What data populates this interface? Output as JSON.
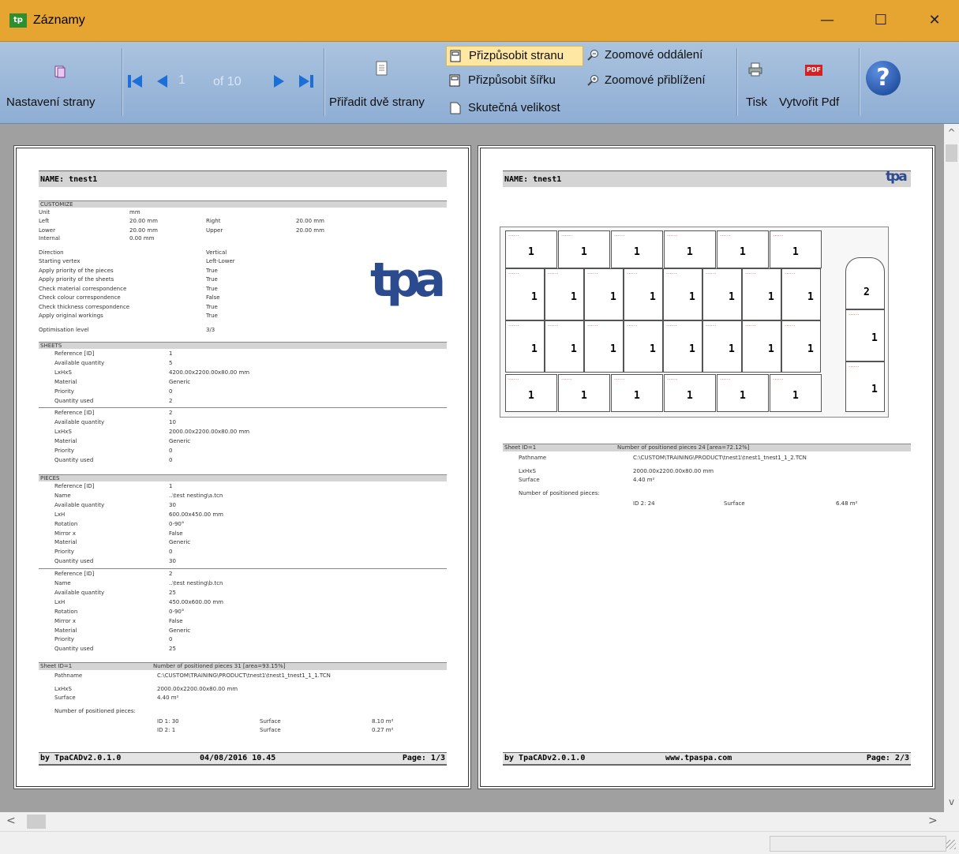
{
  "window": {
    "title": "Záznamy",
    "app_icon": "tpa-app-icon",
    "minimize": "—",
    "maximize": "☐",
    "close": "✕"
  },
  "toolbar": {
    "page_setup_label": "Nastavení strany",
    "nav": {
      "current_page": "1",
      "of_label": "of 10"
    },
    "two_pages_label": "Přiřadit dvě strany",
    "fit_page_label": "Přizpůsobit stranu",
    "fit_width_label": "Přizpůsobit šířku",
    "actual_size_label": "Skutečná velikost",
    "zoom_out_label": "Zoomové oddálení",
    "zoom_in_label": "Zoomové přiblížení",
    "print_label": "Tisk",
    "create_pdf_label": "Vytvořit Pdf",
    "pdf_badge": "PDF",
    "help_glyph": "?"
  },
  "page1": {
    "name_header": "NAME: tnest1",
    "customize": {
      "title": "CUSTOMIZE",
      "unit_label": "Unit",
      "unit_value": "mm",
      "left_label": "Left",
      "left_value": "20.00 mm",
      "right_label": "Right",
      "right_value": "20.00 mm",
      "lower_label": "Lower",
      "lower_value": "20.00 mm",
      "upper_label": "Upper",
      "upper_value": "20.00 mm",
      "internal_label": "Internal",
      "internal_value": "0.00 mm",
      "options": [
        {
          "label": "Direction",
          "value": "Vertical"
        },
        {
          "label": "Starting vertex",
          "value": "Left-Lower"
        },
        {
          "label": "Apply priority of the pieces",
          "value": "True"
        },
        {
          "label": "Apply priority of the sheets",
          "value": "True"
        },
        {
          "label": "Check material correspondence",
          "value": "True"
        },
        {
          "label": "Check colour correspondence",
          "value": "False"
        },
        {
          "label": "Check thickness correspondence",
          "value": "True"
        },
        {
          "label": "Apply original workings",
          "value": "True"
        }
      ],
      "opt_level_label": "Optimisation level",
      "opt_level_value": "3/3"
    },
    "sheets": {
      "title": "SHEETS",
      "items": [
        [
          {
            "label": "Reference [ID]",
            "value": "1"
          },
          {
            "label": "Available quantity",
            "value": "5"
          },
          {
            "label": "LxHxS",
            "value": "4200.00x2200.00x80.00 mm"
          },
          {
            "label": "Material",
            "value": "Generic"
          },
          {
            "label": "Priority",
            "value": "0"
          },
          {
            "label": "Quantity used",
            "value": "2"
          }
        ],
        [
          {
            "label": "Reference [ID]",
            "value": "2"
          },
          {
            "label": "Available quantity",
            "value": "10"
          },
          {
            "label": "LxHxS",
            "value": "2000.00x2200.00x80.00 mm"
          },
          {
            "label": "Material",
            "value": "Generic"
          },
          {
            "label": "Priority",
            "value": "0"
          },
          {
            "label": "Quantity used",
            "value": "0"
          }
        ]
      ]
    },
    "pieces": {
      "title": "PIECES",
      "items": [
        [
          {
            "label": "Reference [ID]",
            "value": "1"
          },
          {
            "label": "Name",
            "value": "..\\test nesting\\a.tcn"
          },
          {
            "label": "Available quantity",
            "value": "30"
          },
          {
            "label": "LxH",
            "value": "600.00x450.00 mm"
          },
          {
            "label": "Rotation",
            "value": "0-90°"
          },
          {
            "label": "Mirror x",
            "value": "False"
          },
          {
            "label": "Material",
            "value": "Generic"
          },
          {
            "label": "Priority",
            "value": "0"
          },
          {
            "label": "Quantity used",
            "value": "30"
          }
        ],
        [
          {
            "label": "Reference [ID]",
            "value": "2"
          },
          {
            "label": "Name",
            "value": "..\\test nesting\\b.tcn"
          },
          {
            "label": "Available quantity",
            "value": "25"
          },
          {
            "label": "LxH",
            "value": "450.00x600.00 mm"
          },
          {
            "label": "Rotation",
            "value": "0-90°"
          },
          {
            "label": "Mirror x",
            "value": "False"
          },
          {
            "label": "Material",
            "value": "Generic"
          },
          {
            "label": "Priority",
            "value": "0"
          },
          {
            "label": "Quantity used",
            "value": "25"
          }
        ]
      ]
    },
    "sheet_summary": {
      "header_left": "Sheet  ID=1",
      "header_right": "Number of positioned pieces  31   [area=93.15%]",
      "pathname_label": "Pathname",
      "pathname_value": "C:\\CUSTOM\\TRAINING\\PRODUCT\\tnest1\\tnest1_tnest1_1_1.TCN",
      "lxhxs_label": "LxHxS",
      "lxhxs_value": "2000.00x2200.00x80.00 mm",
      "surface_label": "Surface",
      "surface_value": "4.40  m²",
      "npp_label": "Number of positioned pieces:",
      "rows": [
        {
          "id": "ID  1:  30",
          "surface_label": "Surface",
          "surface": "8.10  m²"
        },
        {
          "id": "ID  2:  1",
          "surface_label": "Surface",
          "surface": "0.27  m²"
        }
      ]
    },
    "footer": {
      "left": "by TpaCADv2.0.1.0",
      "center": "04/08/2016 10.45",
      "right": "Page: 1/3"
    },
    "logo_text": "tpa"
  },
  "page2": {
    "name_header": "NAME: tnest1",
    "logo_text": "tpa",
    "piece_label_1": "1",
    "piece_label_2": "2",
    "sheet_summary": {
      "header_left": "Sheet  ID=1",
      "header_right": "Number of positioned pieces  24   [area=72.12%]",
      "pathname_label": "Pathname",
      "pathname_value": "C:\\CUSTOM\\TRAINING\\PRODUCT\\tnest1\\tnest1_tnest1_1_2.TCN",
      "lxhxs_label": "LxHxS",
      "lxhxs_value": "2000.00x2200.00x80.00 mm",
      "surface_label": "Surface",
      "surface_value": "4.40  m²",
      "npp_label": "Number of positioned pieces:",
      "row_id": "ID  2:  24",
      "row_surface_label": "Surface",
      "row_surface": "6.48  m²"
    },
    "footer": {
      "left": "by TpaCADv2.0.1.0",
      "center": "www.tpaspa.com",
      "right": "Page: 2/3"
    }
  },
  "scroll": {
    "up": "^",
    "down": "v",
    "left": "<",
    "right": ">"
  }
}
